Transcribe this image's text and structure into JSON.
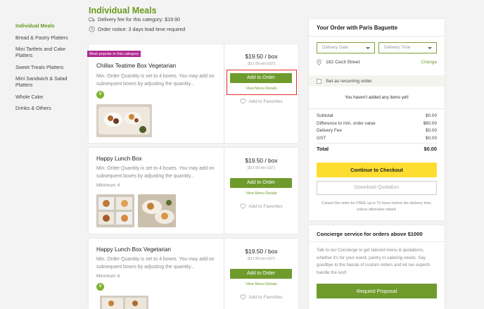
{
  "sidebar": {
    "items": [
      {
        "label": "Individual Meals"
      },
      {
        "label": "Bread & Pastry Platters"
      },
      {
        "label": "Mini Tartlets and Cake Platters"
      },
      {
        "label": "Sweet Treats Platters"
      },
      {
        "label": "Mini Sandwich & Salad Platters"
      },
      {
        "label": "Whole Cake"
      },
      {
        "label": "Drinks & Others"
      }
    ]
  },
  "main": {
    "title": "Individual Meals",
    "delivery_fee": "Delivery fee for this category: $19.90",
    "order_notice": "Order notice: 3 days lead time required"
  },
  "products": [
    {
      "badge": "Most popular in this category",
      "name": "Chillax Teatime Box Vegetarian",
      "desc": "Min. Order Quantity is set to 4 boxes. You may add on subsequent boxes by adjusting the quantity...",
      "minimum": "",
      "veg_badge": "V",
      "price": "$19.50 / box",
      "price_sub": "($17.89 w/o GST)",
      "add_label": "Add to Order",
      "menu_link": "View Menu Details",
      "fav_label": "Add to Favorites"
    },
    {
      "badge": "",
      "name": "Happy Lunch Box",
      "desc": "Min. Order Quantity is set to 4 boxes. You may add on subsequent boxes by adjusting the quantity...",
      "minimum": "Minimum 4",
      "veg_badge": "",
      "price": "$19.50 / box",
      "price_sub": "($17.89 w/o GST)",
      "add_label": "Add to Order",
      "menu_link": "View Menu Details",
      "fav_label": "Add to Favorites"
    },
    {
      "badge": "",
      "name": "Happy Lunch Box Vegetarian",
      "desc": "Min. Order Quantity is set to 4 boxes. You may add on subsequent boxes by adjusting the quantity...",
      "minimum": "Minimum 4",
      "veg_badge": "V",
      "price": "$19.50 / box",
      "price_sub": "($17.89 w/o GST)",
      "add_label": "Add to Order",
      "menu_link": "View Menu Details",
      "fav_label": "Add to Favorites"
    }
  ],
  "order": {
    "title": "Your Order with Paris Baguette",
    "delivery_date_placeholder": "Delivery Date",
    "delivery_time_placeholder": "Delivery Time",
    "address": "182 Cecil Street",
    "change_label": "Change",
    "recurring_label": "Set as recurring order",
    "empty_message": "You haven't added any items yet!",
    "summary": [
      {
        "label": "Subtotal",
        "value": "$0.00"
      },
      {
        "label": "Difference to min. order value",
        "value": "$80.00"
      },
      {
        "label": "Delivery Fee",
        "value": "$0.00"
      },
      {
        "label": "GST",
        "value": "$0.00"
      }
    ],
    "total_label": "Total",
    "total_value": "$0.00",
    "checkout_label": "Continue to Checkout",
    "download_label": "Download Quotation",
    "cancel_note": "Cancel this order for FREE up to 72 hours before the delivery time, unless otherwise stated."
  },
  "concierge": {
    "title": "Concierge service for orders above $1000",
    "text": "Talk to our Concierge to get tailored menu & quotations, whether it's for your event, pantry or catering needs. Say goodbye to the hassle of custom orders and let our experts handle the rest!",
    "button_label": "Request Proposal"
  },
  "colors": {
    "accent_green": "#6e9b2c",
    "checkout_yellow": "#fddd30",
    "badge_magenta": "#b0298f",
    "highlight_red": "#e32b2b"
  }
}
